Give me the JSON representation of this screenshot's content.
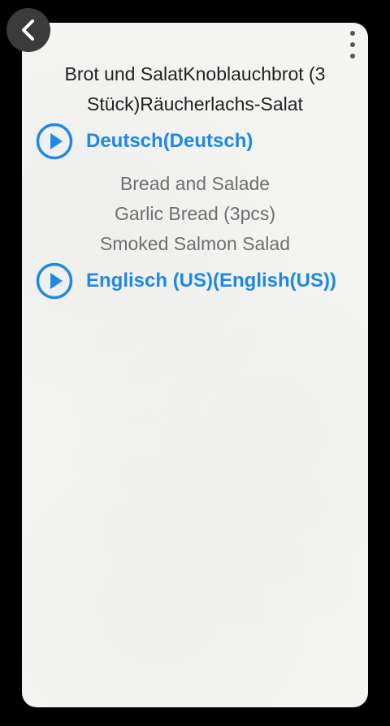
{
  "header": {
    "back_icon": "chevron-left-icon",
    "menu_icon": "more-vertical-icon"
  },
  "source_text": "Brot und SalatKnoblauchbrot (3 Stück)Räucherlachs-Salat",
  "source_language": {
    "label": "Deutsch(Deutsch)",
    "icon": "play-circle-icon"
  },
  "translation_lines": [
    "Bread and Salade",
    "Garlic Bread (3pcs)",
    "Smoked Salmon Salad"
  ],
  "target_language": {
    "label": "Englisch (US)(English(US))",
    "icon": "play-circle-icon"
  },
  "colors": {
    "accent": "#1e88e5",
    "background": "#000000",
    "card": "#f4f4f2",
    "source_text": "#222222",
    "translation_text": "#6f6f6f"
  }
}
